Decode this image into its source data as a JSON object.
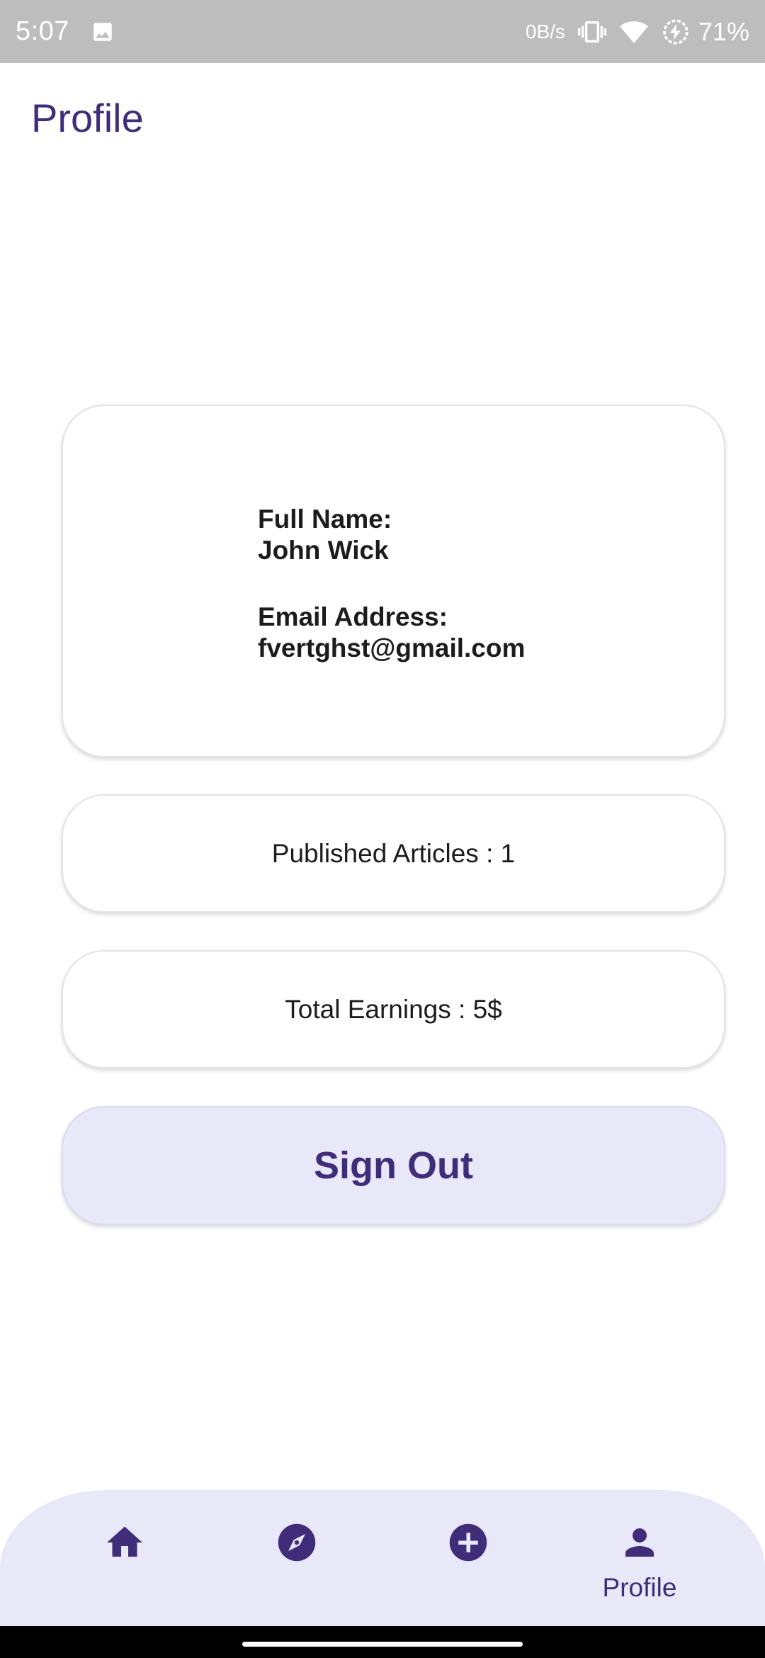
{
  "status_bar": {
    "time": "5:07",
    "network_speed": "0B/s",
    "battery": "71%"
  },
  "app_bar": {
    "title": "Profile"
  },
  "profile": {
    "full_name_label": "Full Name:",
    "full_name": "John Wick",
    "email_label": "Email Address:",
    "email": "fvertghst@gmail.com"
  },
  "stats": {
    "published_articles": "Published Articles : 1",
    "total_earnings": "Total Earnings : 5$"
  },
  "actions": {
    "sign_out_label": "Sign Out"
  },
  "bottom_nav": {
    "items": [
      {
        "icon": "home-icon",
        "label": ""
      },
      {
        "icon": "compass-icon",
        "label": ""
      },
      {
        "icon": "add-circle-icon",
        "label": ""
      },
      {
        "icon": "person-icon",
        "label": "Profile",
        "selected": true
      }
    ]
  },
  "colors": {
    "accent": "#3f2d7a",
    "nav_background": "#e9e8f9",
    "status_bar": "#bdbdbd"
  }
}
